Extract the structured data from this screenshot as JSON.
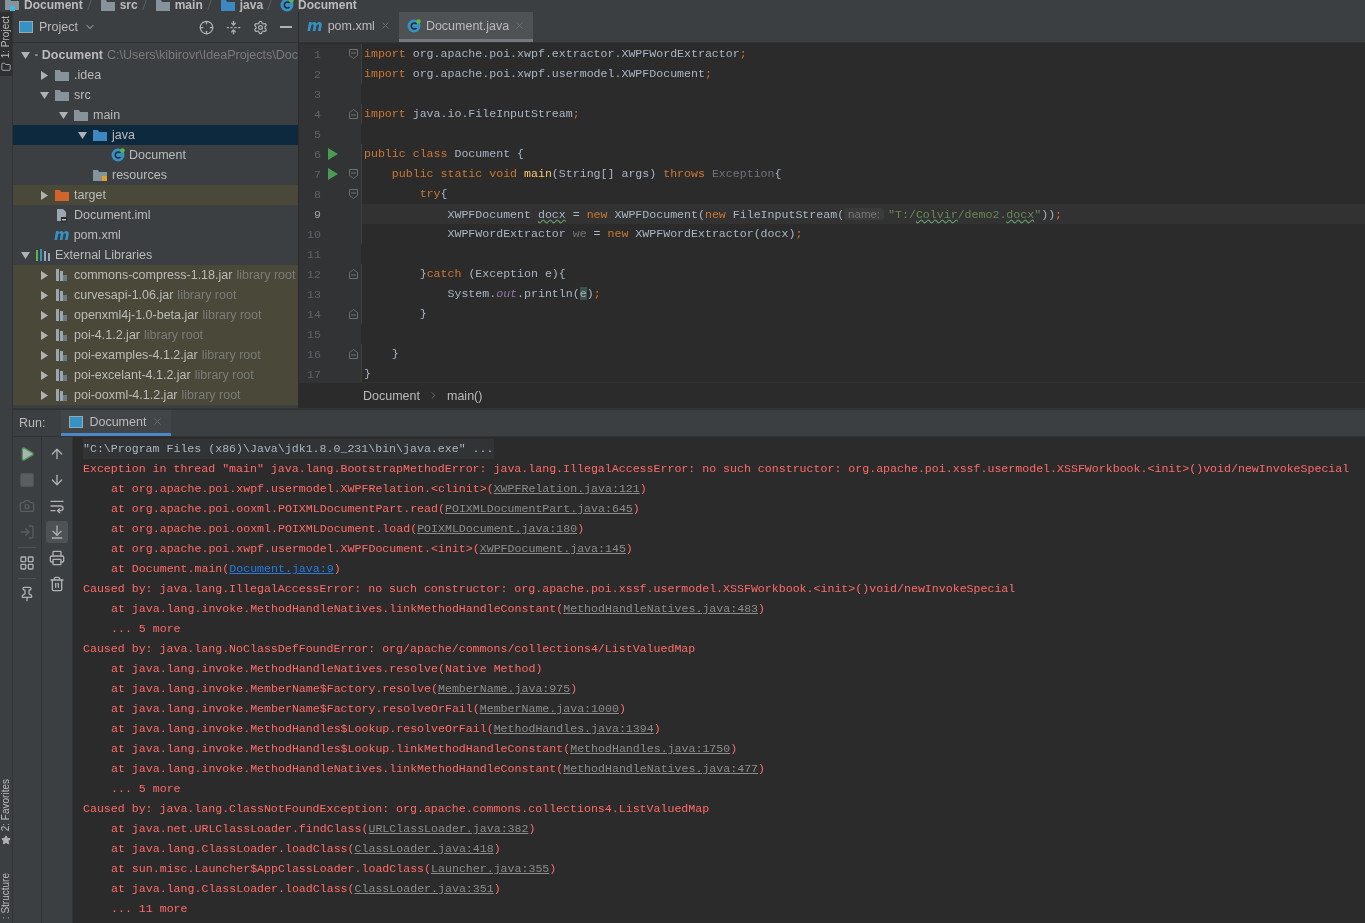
{
  "navigation_bar": {
    "items": [
      {
        "label": "Document",
        "kind": "module"
      },
      {
        "label": "src",
        "kind": "folder"
      },
      {
        "label": "main",
        "kind": "folder"
      },
      {
        "label": "java",
        "kind": "source"
      },
      {
        "label": "Document",
        "kind": "class"
      }
    ]
  },
  "tool_strip": {
    "top": [
      {
        "label": "1: Project",
        "selected": true
      }
    ],
    "bottom": [
      {
        "label": "2: Favorites",
        "selected": false
      },
      {
        "label": ": Structure",
        "selected": false
      }
    ]
  },
  "project_panel": {
    "title": "Project",
    "tree": [
      {
        "label": "Document",
        "hint": "C:\\Users\\kibirovr\\IdeaProjects\\Doc",
        "kind": "module",
        "expanded": true,
        "selected": false,
        "highlighted": false,
        "children": [
          {
            "label": ".idea",
            "kind": "folder",
            "expanded": false,
            "selected": false,
            "highlighted": false
          },
          {
            "label": "src",
            "kind": "folder",
            "expanded": true,
            "selected": false,
            "highlighted": false,
            "children": [
              {
                "label": "main",
                "kind": "folder",
                "expanded": true,
                "selected": false,
                "highlighted": false,
                "children": [
                  {
                    "label": "java",
                    "kind": "source",
                    "expanded": true,
                    "selected": true,
                    "highlighted": false,
                    "children": [
                      {
                        "label": "Document",
                        "kind": "class",
                        "selected": false,
                        "highlighted": false
                      }
                    ]
                  },
                  {
                    "label": "resources",
                    "kind": "resources",
                    "selected": false,
                    "highlighted": false
                  }
                ]
              }
            ]
          },
          {
            "label": "target",
            "kind": "excluded",
            "expanded": false,
            "selected": false,
            "highlighted": true
          },
          {
            "label": "Document.iml",
            "kind": "iml",
            "selected": false,
            "highlighted": false
          },
          {
            "label": "pom.xml",
            "kind": "maven",
            "glyph": "m",
            "selected": false,
            "highlighted": false
          }
        ]
      },
      {
        "label": "External Libraries",
        "kind": "libraries",
        "expanded": true,
        "selected": false,
        "highlighted": false,
        "children": [
          {
            "label": "commons-compress-1.18.jar",
            "hint": "library root",
            "kind": "jar",
            "expanded": false,
            "selected": false,
            "highlighted": true
          },
          {
            "label": "curvesapi-1.06.jar",
            "hint": "library root",
            "kind": "jar",
            "expanded": false,
            "selected": false,
            "highlighted": true
          },
          {
            "label": "openxml4j-1.0-beta.jar",
            "hint": "library root",
            "kind": "jar",
            "expanded": false,
            "selected": false,
            "highlighted": true
          },
          {
            "label": "poi-4.1.2.jar",
            "hint": "library root",
            "kind": "jar",
            "expanded": false,
            "selected": false,
            "highlighted": true
          },
          {
            "label": "poi-examples-4.1.2.jar",
            "hint": "library root",
            "kind": "jar",
            "expanded": false,
            "selected": false,
            "highlighted": true
          },
          {
            "label": "poi-excelant-4.1.2.jar",
            "hint": "library root",
            "kind": "jar",
            "expanded": false,
            "selected": false,
            "highlighted": true
          },
          {
            "label": "poi-ooxml-4.1.2.jar",
            "hint": "library root",
            "kind": "jar",
            "expanded": false,
            "selected": false,
            "highlighted": true
          }
        ]
      }
    ]
  },
  "editor": {
    "tabs": [
      {
        "label": "pom.xml",
        "kind": "maven",
        "glyph": "m",
        "selected": false
      },
      {
        "label": "Document.java",
        "kind": "class",
        "selected": true
      }
    ],
    "lines": [
      {
        "number": "1",
        "fold_start": true,
        "tokens": [
          {
            "kind": "kw",
            "text": "import"
          },
          {
            "kind": "plain",
            "text": " org.apache.poi.xwpf.extractor.XWPFWordExtractor"
          },
          {
            "kind": "kw",
            "text": ";"
          }
        ]
      },
      {
        "number": "2",
        "tokens": [
          {
            "kind": "kw",
            "text": "import"
          },
          {
            "kind": "plain",
            "text": " org.apache.poi.xwpf.usermodel.XWPFDocument"
          },
          {
            "kind": "kw",
            "text": ";"
          }
        ]
      },
      {
        "number": "3"
      },
      {
        "number": "4",
        "fold_end": true,
        "tokens": [
          {
            "kind": "kw",
            "text": "import"
          },
          {
            "kind": "plain",
            "text": " java.io.FileInputStream"
          },
          {
            "kind": "kw",
            "text": ";"
          }
        ]
      },
      {
        "number": "5"
      },
      {
        "number": "6",
        "run": true,
        "tokens": [
          {
            "kind": "kw",
            "text": "public class"
          },
          {
            "kind": "plain",
            "text": " Document {"
          }
        ]
      },
      {
        "number": "7",
        "run": true,
        "fold_start": true,
        "tokens": [
          {
            "kind": "kw",
            "text": "    public static void"
          },
          {
            "kind": "fn",
            "text": " main"
          },
          {
            "kind": "plain",
            "text": "(String[] args) "
          },
          {
            "kind": "kw",
            "text": "throws"
          },
          {
            "kind": "unused",
            "text": " Exception"
          },
          {
            "kind": "plain",
            "text": "{"
          }
        ]
      },
      {
        "number": "8",
        "fold_start": true,
        "tokens": [
          {
            "kind": "kw",
            "text": "        try"
          },
          {
            "kind": "plain",
            "text": "{"
          }
        ]
      },
      {
        "number": "9",
        "current": true,
        "tokens": [
          {
            "kind": "plain",
            "text": "            XWPFDocument "
          },
          {
            "kind": "typo",
            "text": "docx"
          },
          {
            "kind": "plain",
            "text": " = "
          },
          {
            "kind": "kw",
            "text": "new"
          },
          {
            "kind": "plain",
            "text": " XWPFDocument("
          },
          {
            "kind": "kw",
            "text": "new"
          },
          {
            "kind": "plain",
            "text": " FileInputStream("
          },
          {
            "kind": "hint",
            "text": "name:"
          },
          {
            "kind": "str",
            "text": "\"T:/"
          },
          {
            "kind": "str_typo",
            "text": "Colvir"
          },
          {
            "kind": "str",
            "text": "/demo2."
          },
          {
            "kind": "str_typo",
            "text": "docx"
          },
          {
            "kind": "str",
            "text": "\""
          },
          {
            "kind": "plain",
            "text": "))"
          },
          {
            "kind": "kw",
            "text": ";"
          }
        ]
      },
      {
        "number": "10",
        "tokens": [
          {
            "kind": "plain",
            "text": "            XWPFWordExtractor "
          },
          {
            "kind": "unused",
            "text": "we"
          },
          {
            "kind": "plain",
            "text": " = "
          },
          {
            "kind": "kw",
            "text": "new"
          },
          {
            "kind": "plain",
            "text": " XWPFWordExtractor(docx)"
          },
          {
            "kind": "kw",
            "text": ";"
          }
        ]
      },
      {
        "number": "11"
      },
      {
        "number": "12",
        "fold_end": true,
        "tokens": [
          {
            "kind": "plain",
            "text": "        }"
          },
          {
            "kind": "kw",
            "text": "catch"
          },
          {
            "kind": "plain",
            "text": " (Exception e){"
          }
        ]
      },
      {
        "number": "13",
        "tokens": [
          {
            "kind": "plain",
            "text": "            System."
          },
          {
            "kind": "static",
            "text": "out"
          },
          {
            "kind": "plain",
            "text": ".println("
          },
          {
            "kind": "match",
            "text": "e"
          },
          {
            "kind": "plain",
            "text": ")"
          },
          {
            "kind": "kw",
            "text": ";"
          }
        ]
      },
      {
        "number": "14",
        "fold_end": true,
        "tokens": [
          {
            "kind": "plain",
            "text": "        }"
          }
        ]
      },
      {
        "number": "15"
      },
      {
        "number": "16",
        "fold_end": true,
        "tokens": [
          {
            "kind": "plain",
            "text": "    }"
          }
        ]
      },
      {
        "number": "17",
        "tokens": [
          {
            "kind": "plain",
            "text": "}"
          }
        ]
      }
    ],
    "breadcrumbs": [
      "Document",
      "main()"
    ]
  },
  "run_panel": {
    "label": "Run:",
    "tabs": [
      {
        "label": "Document",
        "selected": true
      }
    ],
    "left_tools": [
      {
        "kind": "rerun",
        "disabled": false
      },
      {
        "kind": "stop",
        "disabled": true
      },
      {
        "kind": "dump",
        "disabled": true
      },
      {
        "kind": "exit",
        "disabled": true
      },
      {
        "kind": "layout",
        "disabled": false
      },
      {
        "kind": "pin",
        "disabled": false
      }
    ],
    "right_tools": [
      {
        "kind": "up",
        "on": false
      },
      {
        "kind": "down",
        "on": false
      },
      {
        "kind": "wrap",
        "on": false
      },
      {
        "kind": "scroll_end",
        "on": true
      },
      {
        "kind": "print",
        "on": false
      },
      {
        "kind": "clear",
        "on": false
      }
    ],
    "console": [
      {
        "kind": "cmd",
        "text": "\"C:\\Program Files (x86)\\Java\\jdk1.8.0_231\\bin\\java.exe\" ..."
      },
      {
        "kind": "head",
        "text": "Exception in thread \"main\" java.lang.BootstrapMethodError: java.lang.IllegalAccessError: no such constructor: org.apache.poi.xssf.usermodel.XSSFWorkbook.<init>()void/newInvokeSpecial"
      },
      {
        "kind": "frame",
        "text": "at org.apache.poi.xwpf.usermodel.XWPFRelation.<clinit>(",
        "link": "XWPFRelation.java:121",
        "source": false,
        "tail": ")"
      },
      {
        "kind": "frame",
        "text": "at org.apache.poi.ooxml.POIXMLDocumentPart.read(",
        "link": "POIXMLDocumentPart.java:645",
        "source": false,
        "tail": ")"
      },
      {
        "kind": "frame",
        "text": "at org.apache.poi.ooxml.POIXMLDocument.load(",
        "link": "POIXMLDocument.java:180",
        "source": false,
        "tail": ")"
      },
      {
        "kind": "frame",
        "text": "at org.apache.poi.xwpf.usermodel.XWPFDocument.<init>(",
        "link": "XWPFDocument.java:145",
        "source": false,
        "tail": ")"
      },
      {
        "kind": "frame",
        "text": "at Document.main(",
        "link": "Document.java:9",
        "source": true,
        "tail": ")"
      },
      {
        "kind": "head",
        "text": "Caused by: java.lang.IllegalAccessError: no such constructor: org.apache.poi.xssf.usermodel.XSSFWorkbook.<init>()void/newInvokeSpecial"
      },
      {
        "kind": "frame",
        "text": "at java.lang.invoke.MethodHandleNatives.linkMethodHandleConstant(",
        "link": "MethodHandleNatives.java:483",
        "source": false,
        "tail": ")"
      },
      {
        "kind": "frame",
        "text": "... 5 more"
      },
      {
        "kind": "head",
        "text": "Caused by: java.lang.NoClassDefFoundError: org/apache/commons/collections4/ListValuedMap"
      },
      {
        "kind": "frame",
        "text": "at java.lang.invoke.MethodHandleNatives.resolve(Native Method)"
      },
      {
        "kind": "frame",
        "text": "at java.lang.invoke.MemberName$Factory.resolve(",
        "link": "MemberName.java:975",
        "source": false,
        "tail": ")"
      },
      {
        "kind": "frame",
        "text": "at java.lang.invoke.MemberName$Factory.resolveOrFail(",
        "link": "MemberName.java:1000",
        "source": false,
        "tail": ")"
      },
      {
        "kind": "frame",
        "text": "at java.lang.invoke.MethodHandles$Lookup.resolveOrFail(",
        "link": "MethodHandles.java:1394",
        "source": false,
        "tail": ")"
      },
      {
        "kind": "frame",
        "text": "at java.lang.invoke.MethodHandles$Lookup.linkMethodHandleConstant(",
        "link": "MethodHandles.java:1750",
        "source": false,
        "tail": ")"
      },
      {
        "kind": "frame",
        "text": "at java.lang.invoke.MethodHandleNatives.linkMethodHandleConstant(",
        "link": "MethodHandleNatives.java:477",
        "source": false,
        "tail": ")"
      },
      {
        "kind": "frame",
        "text": "... 5 more"
      },
      {
        "kind": "head",
        "text": "Caused by: java.lang.ClassNotFoundException: org.apache.commons.collections4.ListValuedMap"
      },
      {
        "kind": "frame",
        "text": "at java.net.URLClassLoader.findClass(",
        "link": "URLClassLoader.java:382",
        "source": false,
        "tail": ")"
      },
      {
        "kind": "frame",
        "text": "at java.lang.ClassLoader.loadClass(",
        "link": "ClassLoader.java:418",
        "source": false,
        "tail": ")"
      },
      {
        "kind": "frame",
        "text": "at sun.misc.Launcher$AppClassLoader.loadClass(",
        "link": "Launcher.java:355",
        "source": false,
        "tail": ")"
      },
      {
        "kind": "frame",
        "text": "at java.lang.ClassLoader.loadClass(",
        "link": "ClassLoader.java:351",
        "source": false,
        "tail": ")"
      },
      {
        "kind": "frame",
        "text": "... 11 more"
      }
    ]
  }
}
